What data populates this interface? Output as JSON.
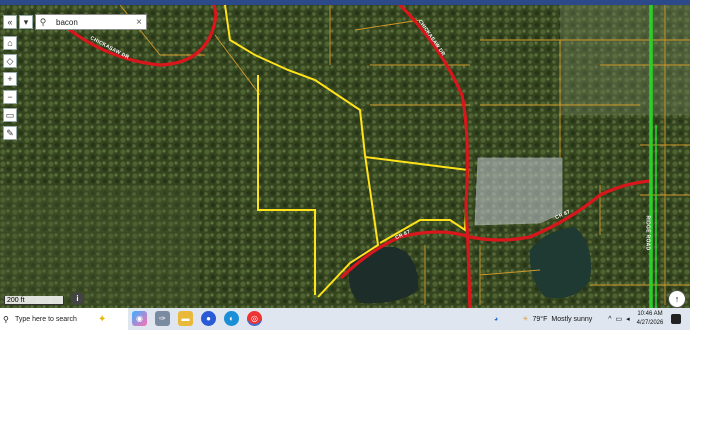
{
  "search": {
    "value": "bacon"
  },
  "map": {
    "scale_label": "200 ft",
    "info_glyph": "i",
    "north_glyph": "↑",
    "road_labels": [
      "CHICKASAW DR",
      "CHICKASAW DR",
      "RIDGE ROAD",
      "CR 87"
    ]
  },
  "taskbar": {
    "search_placeholder": "Type here to search",
    "weather_temp": "79°F",
    "weather_text": "Mostly sunny",
    "time": "10:46 AM",
    "date": "4/27/2026"
  }
}
